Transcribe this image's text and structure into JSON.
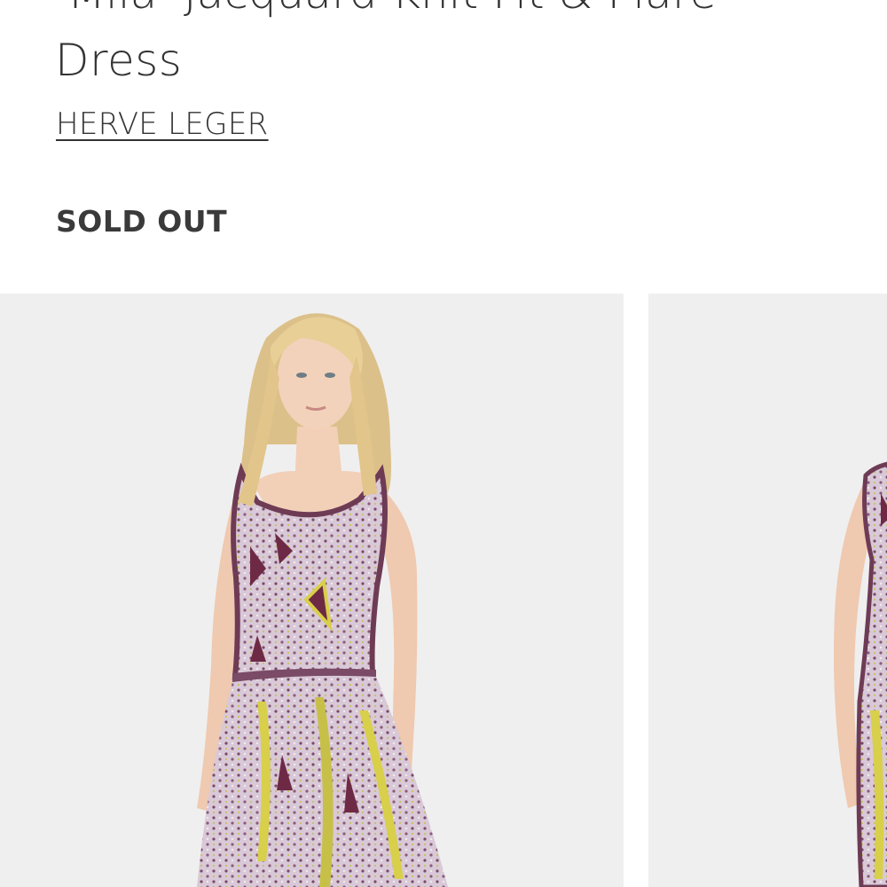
{
  "product": {
    "title_line_1": "'Mila' Jacquard Knit Fit & Flare",
    "title_line_2": "Dress",
    "brand": "HERVE LEGER",
    "status": "SOLD OUT"
  },
  "gallery": {
    "images": [
      {
        "alt": "Model wearing 'Mila' Jacquard Knit Fit & Flare Dress, front view"
      },
      {
        "alt": "Model wearing 'Mila' Jacquard Knit Fit & Flare Dress, alternate view"
      }
    ]
  },
  "colors": {
    "text": "#333333",
    "image_background": "#efefef",
    "dress_base": "#d9c9d8",
    "dress_plum": "#6e2a45",
    "dress_yellow": "#d8cf4a",
    "hair": "#e2c98f",
    "skin": "#f0cdb5"
  }
}
